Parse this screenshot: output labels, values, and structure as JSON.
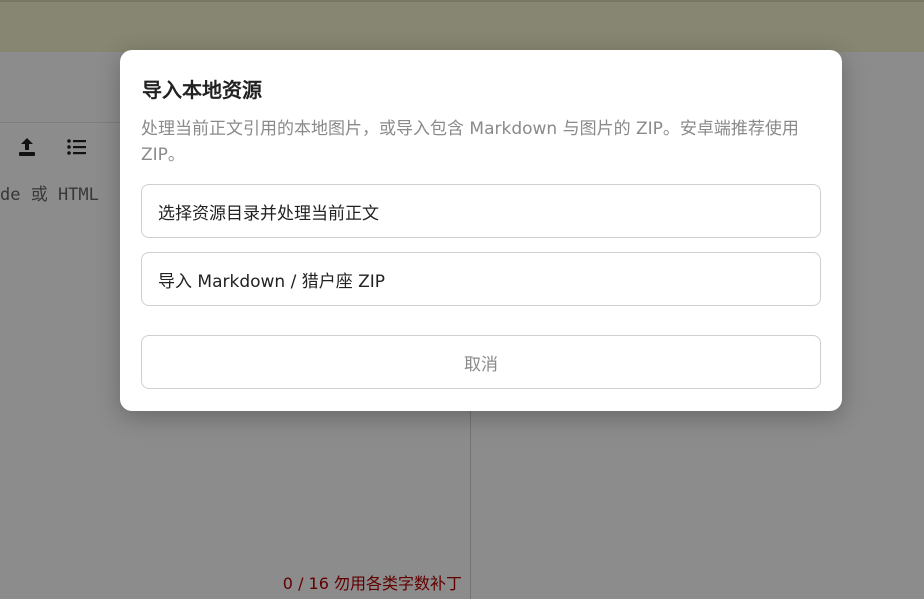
{
  "app": {
    "editor_placeholder": "de 或 HTML",
    "word_count": "0 / 16 勿用各类字数补丁",
    "toolbar": {
      "icons": [
        "upload-icon",
        "list-icon"
      ]
    },
    "colors": {
      "topbar": "#f4f4cf",
      "word_count": "#b00000"
    }
  },
  "dialog": {
    "title": "导入本地资源",
    "description": "处理当前正文引用的本地图片，或导入包含 Markdown 与图片的 ZIP。安卓端推荐使用 ZIP。",
    "buttons": {
      "choose_dir": "选择资源目录并处理当前正文",
      "import_zip": "导入 Markdown / 猎户座 ZIP",
      "cancel": "取消"
    }
  }
}
